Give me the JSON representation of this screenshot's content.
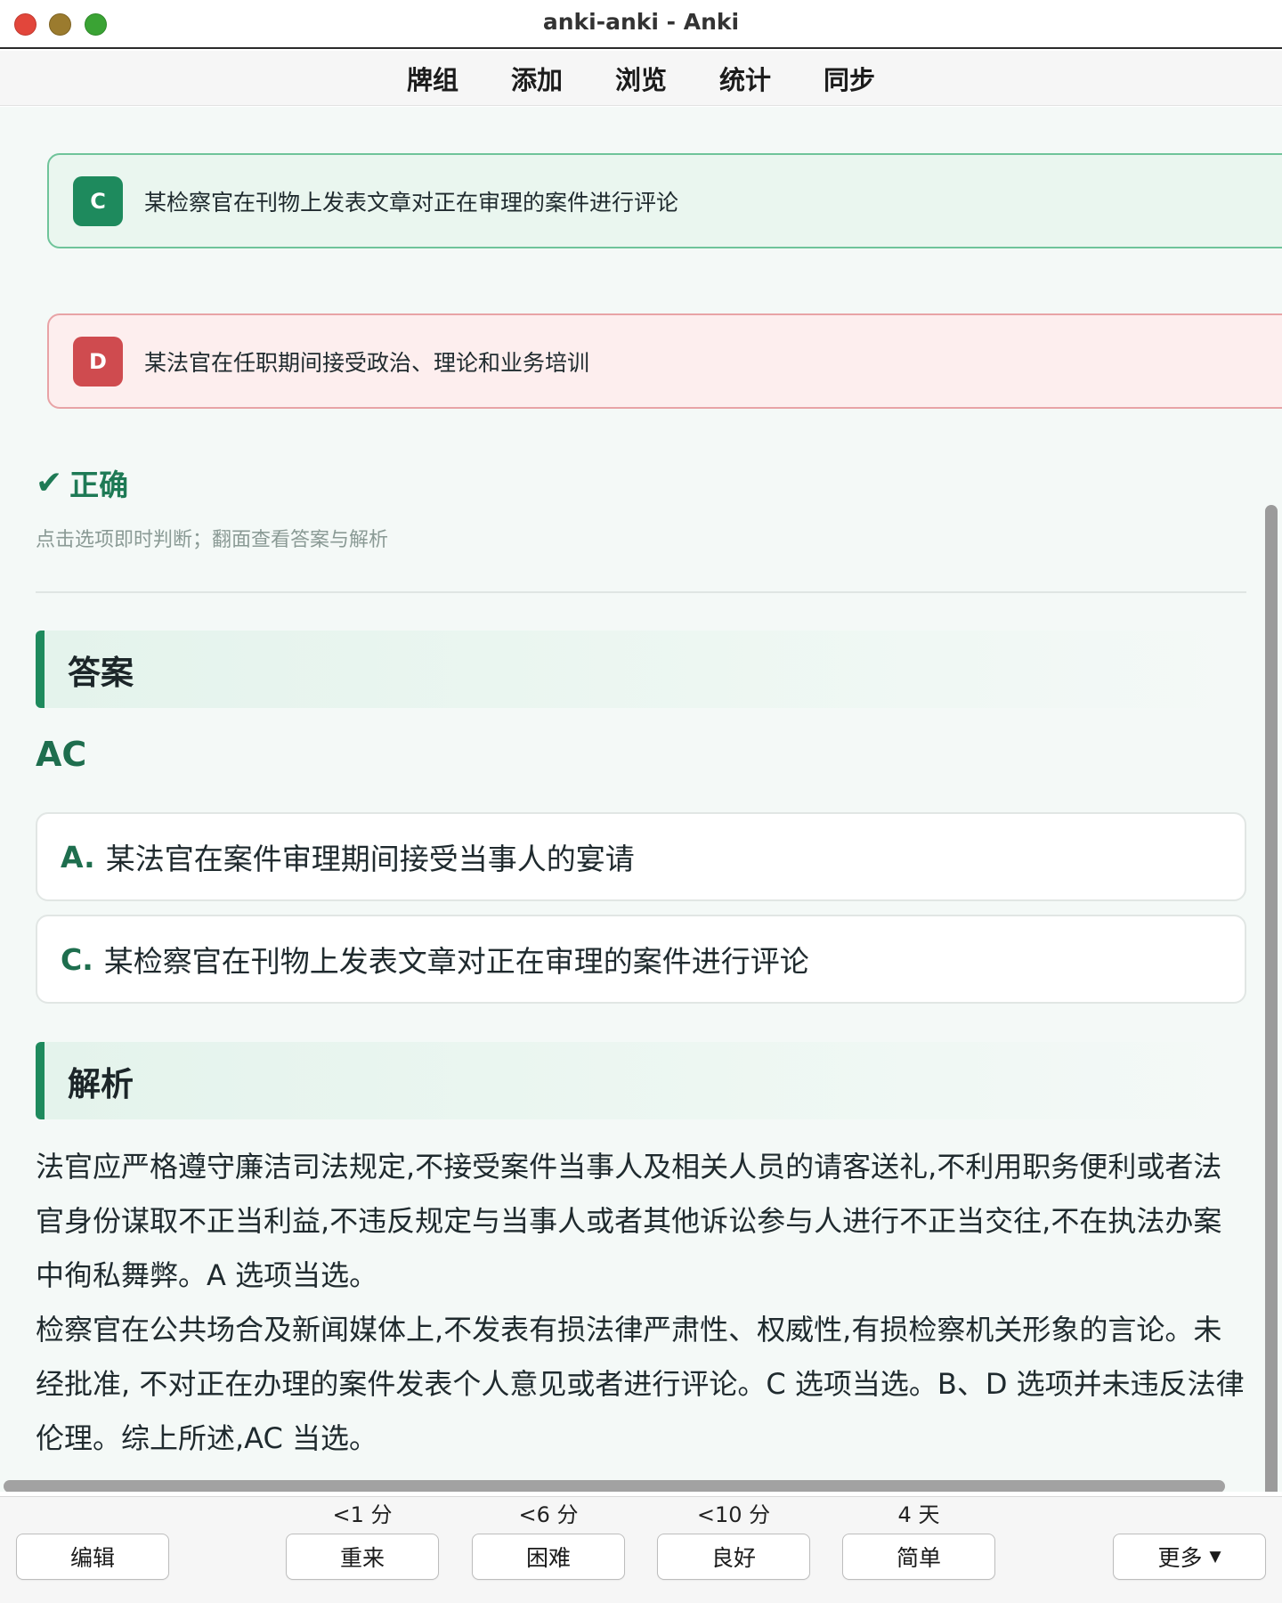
{
  "window": {
    "title": "anki-anki - Anki"
  },
  "topnav": {
    "items": [
      "牌组",
      "添加",
      "浏览",
      "统计",
      "同步"
    ]
  },
  "options": [
    {
      "letter": "C",
      "text": "某检察官在刊物上发表文章对正在审理的案件进行评论",
      "state": "correct"
    },
    {
      "letter": "D",
      "text": "某法官在任职期间接受政治、理论和业务培训",
      "state": "wrong"
    }
  ],
  "result": {
    "icon": "check-icon",
    "label": "正确",
    "hint": "点击选项即时判断；翻面查看答案与解析"
  },
  "answer": {
    "heading": "答案",
    "value": "AC",
    "items": [
      {
        "letter": "A.",
        "text": "某法官在案件审理期间接受当事人的宴请"
      },
      {
        "letter": "C.",
        "text": "某检察官在刊物上发表文章对正在审理的案件进行评论"
      }
    ]
  },
  "analysis": {
    "heading": "解析",
    "paragraphs": [
      "法官应严格遵守廉洁司法规定,不接受案件当事人及相关人员的请客送礼,不利用职务便利或者法官身份谋取不正当利益,不违反规定与当事人或者其他诉讼参与人进行不正当交往,不在执法办案中徇私舞弊。A 选项当选。",
      "检察官在公共场合及新闻媒体上,不发表有损法律严肃性、权威性,有损检察机关形象的言论。未经批准, 不对正在办理的案件发表个人意见或者进行评论。C 选项当选。B、D 选项并未违反法律伦理。综上所述,AC 当选。"
    ]
  },
  "bottombar": {
    "edit_label": "编辑",
    "answers": [
      {
        "interval": "<1 分",
        "label": "重来"
      },
      {
        "interval": "<6 分",
        "label": "困难"
      },
      {
        "interval": "<10 分",
        "label": "良好"
      },
      {
        "interval": "4 天",
        "label": "简单"
      }
    ],
    "more_label": "更多",
    "more_icon": "caret-down-icon"
  },
  "colors": {
    "accent_green": "#1e8a5d",
    "wrong_red": "#cf4b4f",
    "content_bg": "#f4f9f7"
  }
}
